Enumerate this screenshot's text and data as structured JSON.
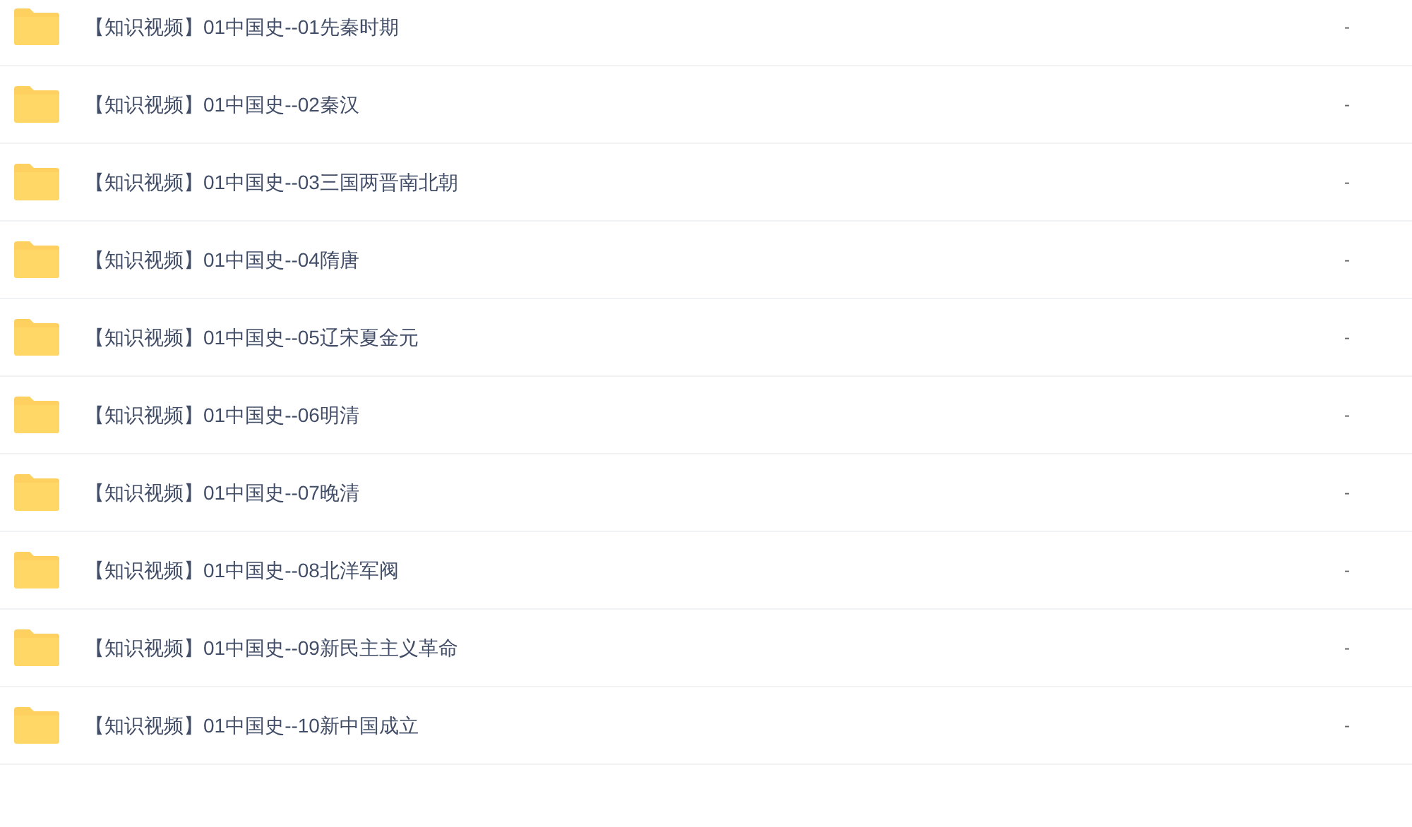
{
  "files": [
    {
      "name": "【知识视频】01中国史--01先秦时期",
      "size": "-"
    },
    {
      "name": "【知识视频】01中国史--02秦汉",
      "size": "-"
    },
    {
      "name": "【知识视频】01中国史--03三国两晋南北朝",
      "size": "-"
    },
    {
      "name": "【知识视频】01中国史--04隋唐",
      "size": "-"
    },
    {
      "name": "【知识视频】01中国史--05辽宋夏金元",
      "size": "-"
    },
    {
      "name": "【知识视频】01中国史--06明清",
      "size": "-"
    },
    {
      "name": "【知识视频】01中国史--07晚清",
      "size": "-"
    },
    {
      "name": "【知识视频】01中国史--08北洋军阀",
      "size": "-"
    },
    {
      "name": "【知识视频】01中国史--09新民主主义革命",
      "size": "-"
    },
    {
      "name": "【知识视频】01中国史--10新中国成立",
      "size": "-"
    }
  ]
}
